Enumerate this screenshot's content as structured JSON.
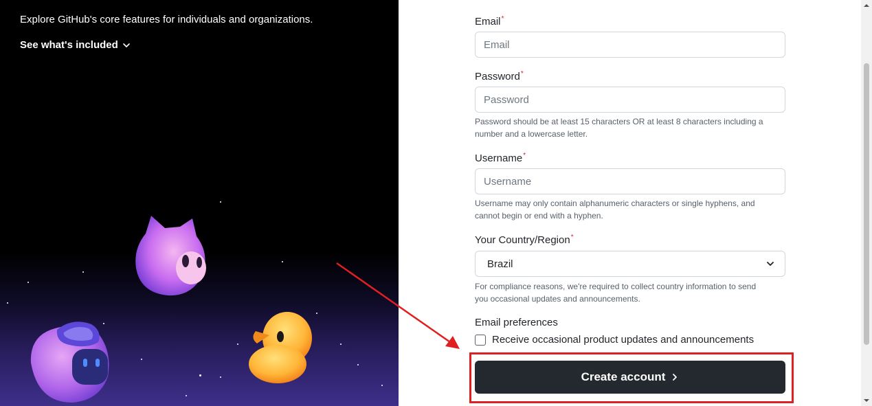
{
  "hero": {
    "description": "Explore GitHub's core features for individuals and organizations.",
    "see_included_label": "See what's included"
  },
  "form": {
    "email": {
      "label": "Email",
      "required_mark": "*",
      "placeholder": "Email",
      "value": ""
    },
    "password": {
      "label": "Password",
      "required_mark": "*",
      "placeholder": "Password",
      "value": "",
      "hint_line1": "Password should be at least 15 characters OR at least 8 characters including a",
      "hint_line2": "number and a lowercase letter."
    },
    "username": {
      "label": "Username",
      "required_mark": "*",
      "placeholder": "Username",
      "value": "",
      "hint_line1": "Username may only contain alphanumeric characters or single hyphens, and",
      "hint_line2": "cannot begin or end with a hyphen."
    },
    "country": {
      "label": "Your Country/Region",
      "required_mark": "*",
      "selected": "Brazil",
      "hint_line1": "For compliance reasons, we're required to collect country information to send",
      "hint_line2": "you occasional updates and announcements."
    },
    "email_preferences": {
      "label": "Email preferences",
      "checkbox_label": "Receive occasional product updates and announcements",
      "checked": false
    },
    "create_account_label": "Create account"
  },
  "colors": {
    "button_bg": "#24292f",
    "annotation": "#e02020",
    "hero_bg": "#000000"
  },
  "icons": [
    "chevron-down-icon",
    "chevron-right-icon"
  ]
}
